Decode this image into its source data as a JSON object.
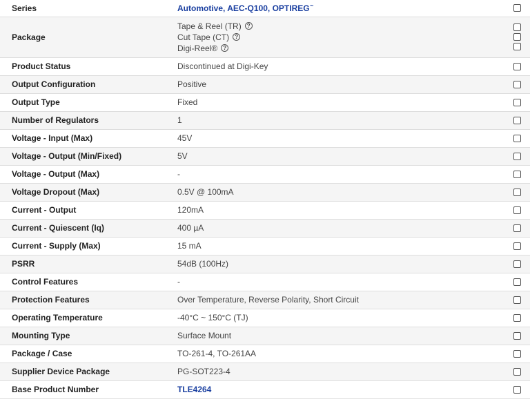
{
  "rows": [
    {
      "label": "Series",
      "value": "Automotive, AEC-Q100, OPTIREG",
      "value_suffix": "™",
      "link": true
    },
    {
      "label": "Package",
      "packaging": [
        "Tape & Reel (TR)",
        "Cut Tape (CT)",
        "Digi-Reel®"
      ]
    },
    {
      "label": "Product Status",
      "value": "Discontinued at Digi-Key"
    },
    {
      "label": "Output Configuration",
      "value": "Positive"
    },
    {
      "label": "Output Type",
      "value": "Fixed"
    },
    {
      "label": "Number of Regulators",
      "value": "1"
    },
    {
      "label": "Voltage - Input (Max)",
      "value": "45V"
    },
    {
      "label": "Voltage - Output (Min/Fixed)",
      "value": "5V"
    },
    {
      "label": "Voltage - Output (Max)",
      "value": "-"
    },
    {
      "label": "Voltage Dropout (Max)",
      "value": "0.5V @ 100mA"
    },
    {
      "label": "Current - Output",
      "value": "120mA"
    },
    {
      "label": "Current - Quiescent (Iq)",
      "value": "400 µA"
    },
    {
      "label": "Current - Supply (Max)",
      "value": "15 mA"
    },
    {
      "label": "PSRR",
      "value": "54dB (100Hz)"
    },
    {
      "label": "Control Features",
      "value": "-"
    },
    {
      "label": "Protection Features",
      "value": "Over Temperature, Reverse Polarity, Short Circuit"
    },
    {
      "label": "Operating Temperature",
      "value": "-40°C ~ 150°C (TJ)"
    },
    {
      "label": "Mounting Type",
      "value": "Surface Mount"
    },
    {
      "label": "Package / Case",
      "value": "TO-261-4, TO-261AA"
    },
    {
      "label": "Supplier Device Package",
      "value": "PG-SOT223-4"
    },
    {
      "label": "Base Product Number",
      "value": "TLE4264",
      "link": true
    }
  ],
  "help_icon_glyph": "?",
  "icons": {
    "help": "question-circle-icon",
    "select": "checkbox"
  },
  "colors": {
    "link": "#1a3fa0",
    "row_alt": "#f5f5f5",
    "border": "#dddddd"
  }
}
